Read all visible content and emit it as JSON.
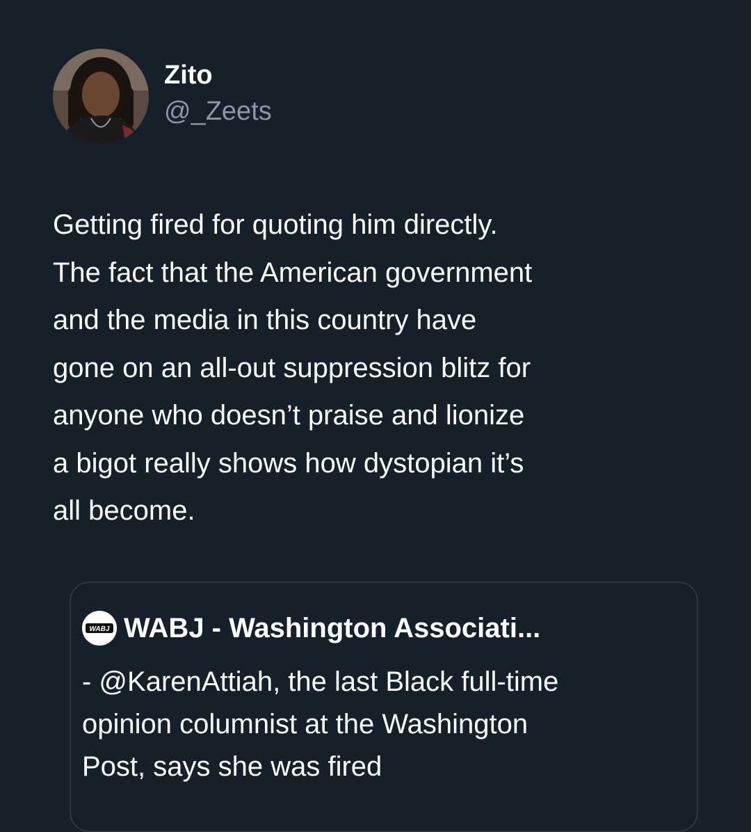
{
  "author": {
    "display_name": "Zito",
    "handle": "@_Zeets",
    "avatar_icon": "profile-photo"
  },
  "tweet": {
    "text_lines": [
      "Getting fired for quoting him directly.",
      "The fact that the American government",
      "and the media in this country have",
      "gone on an all-out suppression blitz for",
      "anyone who doesn’t praise and lionize",
      "a bigot really shows how dystopian it’s",
      "all become."
    ]
  },
  "quoted_tweet": {
    "author_name": "WABJ - Washington Associati...",
    "logo_icon": "wabj-logo",
    "text_lines": [
      "- @KarenAttiah, the last Black full-time",
      "opinion columnist at the Washington",
      "Post, says she was fired"
    ]
  },
  "colors": {
    "background": "#15202b",
    "primary_text": "#ffffff",
    "secondary_text": "#8b98a5",
    "card_border": "#2a3642"
  }
}
